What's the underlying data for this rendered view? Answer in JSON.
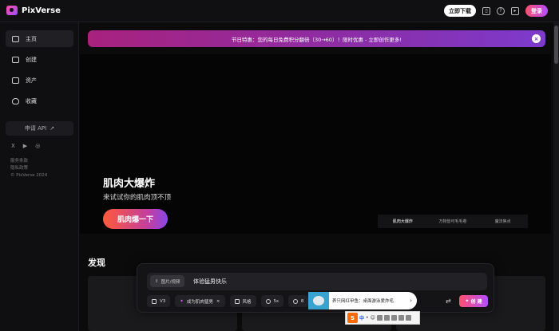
{
  "topbar": {
    "brand": "PixVerse",
    "download_label": "立即下载",
    "login_label": "登录",
    "icons": [
      "book-icon",
      "help-icon",
      "video-icon"
    ]
  },
  "sidebar": {
    "items": [
      {
        "label": "主页",
        "icon": "home-icon"
      },
      {
        "label": "创建",
        "icon": "camera-icon"
      },
      {
        "label": "资产",
        "icon": "folder-icon"
      },
      {
        "label": "收藏",
        "icon": "heart-icon"
      }
    ],
    "api_label": "申请 API",
    "socials": [
      "X",
      "▶",
      "◎"
    ],
    "footer": [
      "服务条款",
      "隐私政策",
      "© PixVerse 2024"
    ]
  },
  "banner": {
    "text": "节日特惠：您的每日免费积分翻倍（30→60）！限时优惠 - 立即创作更多!",
    "close": "×"
  },
  "hero": {
    "title": "肌肉大爆炸",
    "subtitle": "来试试你的肌肉顶不顶",
    "button": "肌肉爆一下",
    "tabs": [
      "肌肉大爆炸",
      "万物皆可毛毛卷",
      "魔法焦点"
    ]
  },
  "discover": {
    "title": "发现"
  },
  "prompt": {
    "upload_label": "图片/视频",
    "text": "体验猛男快乐",
    "options": [
      {
        "label": "V3",
        "icon": "model-icon"
      },
      {
        "label": "成为肌肉猛男",
        "icon": "effect-icon",
        "close": "×"
      },
      {
        "label": "风格",
        "icon": "style-icon"
      },
      {
        "label": "5s",
        "icon": "clock-icon"
      },
      {
        "label": "8",
        "icon": "aspect-icon"
      }
    ],
    "create_label": "创 建",
    "tune_icon": "⇄"
  },
  "suggestion": {
    "text": "养只网红甲鱼：桌面游泳爱炸毛",
    "arrow": "›"
  },
  "ime": {
    "logo": "S",
    "lang": "中",
    "symbols": "•",
    "punct": "☺"
  },
  "colors": {
    "accent_start": "#ff4f6e",
    "accent_end": "#b44dff",
    "banner": "#8a2ea8"
  }
}
